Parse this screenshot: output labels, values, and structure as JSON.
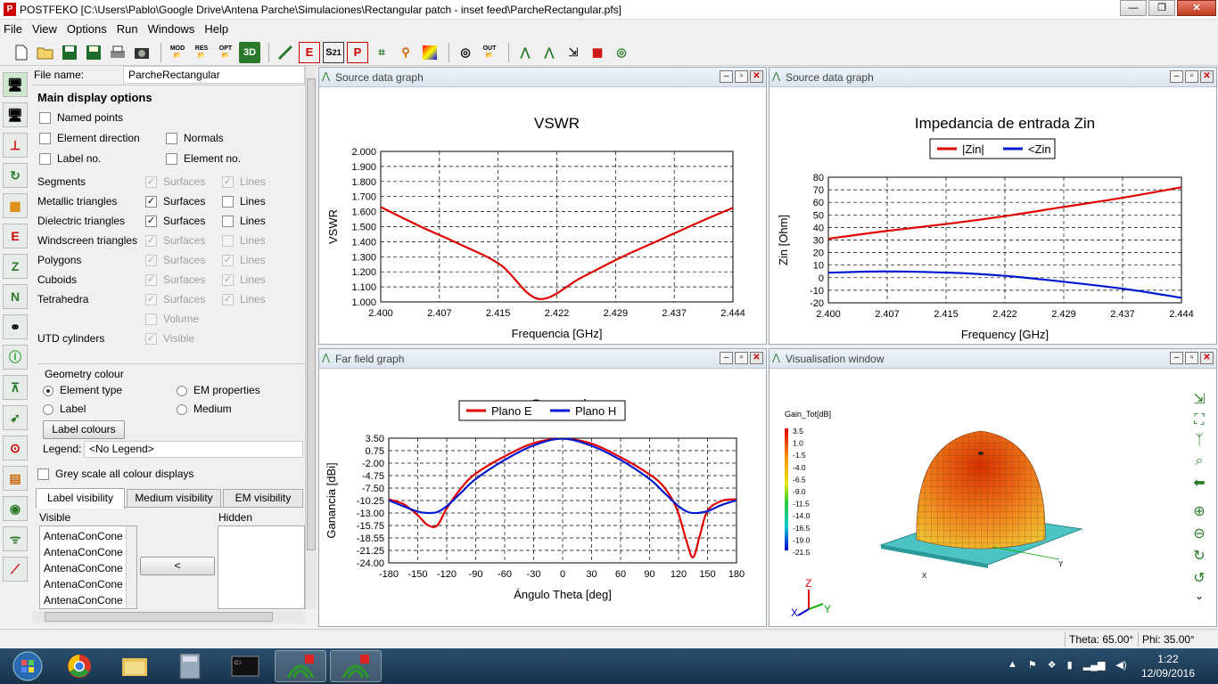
{
  "window": {
    "title": "POSTFEKO [C:\\Users\\Pablo\\Google Drive\\Antena Parche\\Simulaciones\\Rectangular patch - inset feed\\ParcheRectangular.pfs]"
  },
  "menu": [
    "File",
    "View",
    "Options",
    "Run",
    "Windows",
    "Help"
  ],
  "toolbar": {
    "mod": "MOD",
    "res": "RES",
    "opt": "OPT",
    "3d": "3D",
    "out": "OUT"
  },
  "panel": {
    "file_name_label": "File name:",
    "file_name_value": "ParcheRectangular",
    "main_display_heading": "Main display options",
    "named_points": "Named points",
    "element_direction": "Element direction",
    "normals": "Normals",
    "label_no": "Label no.",
    "element_no": "Element no.",
    "surfaces": "Surfaces",
    "lines": "Lines",
    "volume": "Volume",
    "visible": "Visible",
    "segments": "Segments",
    "metallic_triangles": "Metallic triangles",
    "dielectric_triangles": "Dielectric triangles",
    "windscreen_triangles": "Windscreen triangles",
    "polygons": "Polygons",
    "cuboids": "Cuboids",
    "tetrahedra": "Tetrahedra",
    "utd_cylinders": "UTD cylinders",
    "geometry_colour": "Geometry colour",
    "element_type": "Element type",
    "em_properties": "EM properties",
    "label": "Label",
    "medium": "Medium",
    "label_colours_btn": "Label colours",
    "legend_label": "Legend:",
    "legend_value": "<No Legend>",
    "grey_scale": "Grey scale all colour displays",
    "tabs": [
      "Label visibility",
      "Medium visibility",
      "EM visibility"
    ],
    "visible_heading": "Visible",
    "hidden_heading": "Hidden",
    "visible_items": [
      "AntenaConCone",
      "AntenaConCone",
      "AntenaConCone",
      "AntenaConCone",
      "AntenaConCone"
    ],
    "move_btn": "<"
  },
  "windows": {
    "vswr": "Source data graph",
    "zin": "Source data graph",
    "gain": "Far field graph",
    "vis": "Visualisation window"
  },
  "charts": {
    "vswr": {
      "title": "VSWR",
      "xlabel": "Frequencia [GHz]",
      "ylabel": "VSWR"
    },
    "zin": {
      "title": "Impedancia de entrada Zin",
      "xlabel": "Frequency [GHz]",
      "ylabel": "Zin [Ohm]",
      "legend": [
        "|Zin|",
        "<Zin"
      ]
    },
    "gain": {
      "title": "Ganancia",
      "xlabel": "Ángulo Theta [deg]",
      "ylabel": "Ganancia [dBi]",
      "legend": [
        "Plano E",
        "Plano H"
      ]
    }
  },
  "vis": {
    "scale_title": "Gain_Tot[dB]",
    "scale": [
      "3.5",
      "1.0",
      "-1.5",
      "-4.0",
      "-6.5",
      "-9.0",
      "-11.5",
      "-14.0",
      "-16.5",
      "-19.0",
      "-21.5"
    ],
    "axis_x": "X",
    "axis_y": "Y",
    "axis_z": "Z"
  },
  "status": {
    "theta": "Theta: 65.00°",
    "phi": "Phi: 35.00°"
  },
  "taskbar": {
    "time": "1:22",
    "date": "12/09/2016"
  },
  "colors": {
    "red": "#e00000",
    "blue": "#0018d0",
    "accent": "#2a7a2a"
  },
  "chart_data": [
    {
      "type": "line",
      "title": "VSWR",
      "xlabel": "Frequencia [GHz]",
      "ylabel": "VSWR",
      "xticks": [
        "2.400",
        "2.407",
        "2.415",
        "2.422",
        "2.429",
        "2.437",
        "2.444"
      ],
      "yticks": [
        "1.000",
        "1.100",
        "1.200",
        "1.300",
        "1.400",
        "1.500",
        "1.600",
        "1.700",
        "1.800",
        "1.900",
        "2.000"
      ],
      "xlim": [
        2.4,
        2.444
      ],
      "ylim": [
        1.0,
        2.0
      ],
      "grid": true,
      "series": [
        {
          "color": "#e00000",
          "x": [
            2.4,
            2.405,
            2.41,
            2.415,
            2.4197,
            2.425,
            2.43,
            2.435,
            2.44,
            2.444
          ],
          "y": [
            1.63,
            1.5,
            1.38,
            1.245,
            1.02,
            1.16,
            1.295,
            1.415,
            1.535,
            1.625
          ]
        }
      ]
    },
    {
      "type": "line",
      "title": "Impedancia de entrada Zin",
      "xlabel": "Frequency [GHz]",
      "ylabel": "Zin [Ohm]",
      "xticks": [
        "2.400",
        "2.407",
        "2.415",
        "2.422",
        "2.429",
        "2.437",
        "2.444"
      ],
      "yticks": [
        "-20",
        "-10",
        "0",
        "10",
        "20",
        "30",
        "40",
        "50",
        "60",
        "70",
        "80"
      ],
      "xlim": [
        2.4,
        2.444
      ],
      "ylim": [
        -20,
        80
      ],
      "grid": true,
      "legend": "top-center",
      "series": [
        {
          "name": "|Zin|",
          "color": "#e00000",
          "x": [
            2.4,
            2.407,
            2.415,
            2.422,
            2.429,
            2.437,
            2.444
          ],
          "y": [
            31,
            37,
            43,
            49,
            56,
            64,
            72
          ]
        },
        {
          "name": "<Zin",
          "color": "#0018d0",
          "x": [
            2.4,
            2.407,
            2.415,
            2.422,
            2.429,
            2.437,
            2.444
          ],
          "y": [
            4,
            5,
            4,
            1.5,
            -3,
            -9,
            -16
          ]
        }
      ]
    },
    {
      "type": "line",
      "title": "Ganancia",
      "xlabel": "Ángulo Theta [deg]",
      "ylabel": "Ganancia [dBi]",
      "xticks": [
        "-180",
        "-150",
        "-120",
        "-90",
        "-60",
        "-30",
        "0",
        "30",
        "60",
        "90",
        "120",
        "150",
        "180"
      ],
      "yticks": [
        "-24.00",
        "-21.25",
        "-18.55",
        "-15.75",
        "-13.00",
        "-10.25",
        "-7.50",
        "-4.75",
        "-2.00",
        "0.75",
        "3.50"
      ],
      "xlim": [
        -180,
        180
      ],
      "ylim": [
        -24,
        3.5
      ],
      "grid": true,
      "legend": "top-center",
      "series": [
        {
          "name": "Plano E",
          "color": "#e00000",
          "x": [
            -180,
            -165,
            -150,
            -140,
            -130,
            -120,
            -105,
            -90,
            -60,
            -30,
            0,
            30,
            60,
            90,
            105,
            118,
            128,
            135,
            142,
            150,
            165,
            180
          ],
          "y": [
            -10,
            -11,
            -13.5,
            -15.6,
            -15.8,
            -12,
            -7.5,
            -4.3,
            -0.5,
            2.4,
            3.4,
            2.3,
            -0.7,
            -4.5,
            -7.3,
            -12,
            -19,
            -22.8,
            -18,
            -12.5,
            -10.3,
            -10.0
          ]
        },
        {
          "name": "Plano H",
          "color": "#0018d0",
          "x": [
            -180,
            -165,
            -150,
            -140,
            -130,
            -120,
            -105,
            -90,
            -60,
            -30,
            0,
            30,
            60,
            90,
            105,
            120,
            130,
            140,
            150,
            165,
            180
          ],
          "y": [
            -10.2,
            -11.5,
            -12.7,
            -13.0,
            -12.8,
            -11.5,
            -8.5,
            -5.5,
            -1.3,
            1.9,
            3.4,
            1.8,
            -1.3,
            -5.5,
            -8.5,
            -11.5,
            -12.8,
            -13.0,
            -12.6,
            -11.2,
            -10.2
          ]
        }
      ]
    }
  ]
}
